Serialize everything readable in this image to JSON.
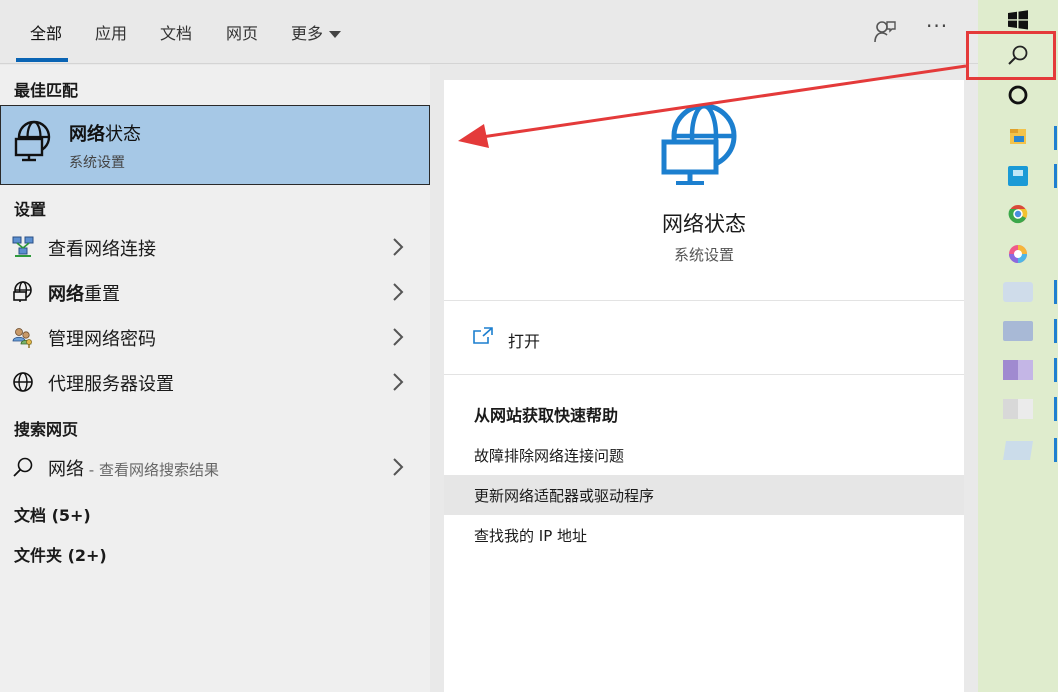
{
  "tabs": {
    "all": "全部",
    "apps": "应用",
    "docs": "文档",
    "web": "网页",
    "more": "更多"
  },
  "top_actions": {
    "ellipsis": "···"
  },
  "left": {
    "best_match_header": "最佳匹配",
    "best_match": {
      "title_bold": "网络",
      "title_rest": "状态",
      "subtitle": "系统设置"
    },
    "settings_header": "设置",
    "settings_items": [
      {
        "label": "查看网络连接",
        "icon": "network-connections-icon"
      },
      {
        "label_bold": "网络",
        "label_rest": "重置",
        "icon": "globe-monitor-icon"
      },
      {
        "label": "管理网络密码",
        "icon": "users-key-icon"
      },
      {
        "label": "代理服务器设置",
        "icon": "globe-icon"
      }
    ],
    "web_header": "搜索网页",
    "web_item": {
      "label": "网络",
      "sub": " - 查看网络搜索结果",
      "icon": "search-icon"
    },
    "docs_header": "文档 (5+)",
    "folders_header": "文件夹 (2+)"
  },
  "preview": {
    "title": "网络状态",
    "subtitle": "系统设置",
    "open_label": "打开",
    "help_header": "从网站获取快速帮助",
    "help_links": [
      "故障排除网络连接问题",
      "更新网络适配器或驱动程序",
      "查找我的 IP 地址"
    ]
  },
  "taskbar_icons": [
    "windows-logo-icon",
    "search-icon",
    "cortana-circle-icon",
    "file-explorer-icon",
    "app-blue-icon",
    "chrome-icon",
    "colorful-app-icon",
    "blurred-app-icon-1",
    "blurred-app-icon-2",
    "blurred-app-icon-3",
    "blurred-app-icon-4",
    "blurred-app-icon-5"
  ],
  "colors": {
    "accent": "#0a64b4",
    "selected_bg": "#a6c8e6",
    "annotation_red": "#e43a3a",
    "taskbar_bg": "#dfeccd"
  }
}
